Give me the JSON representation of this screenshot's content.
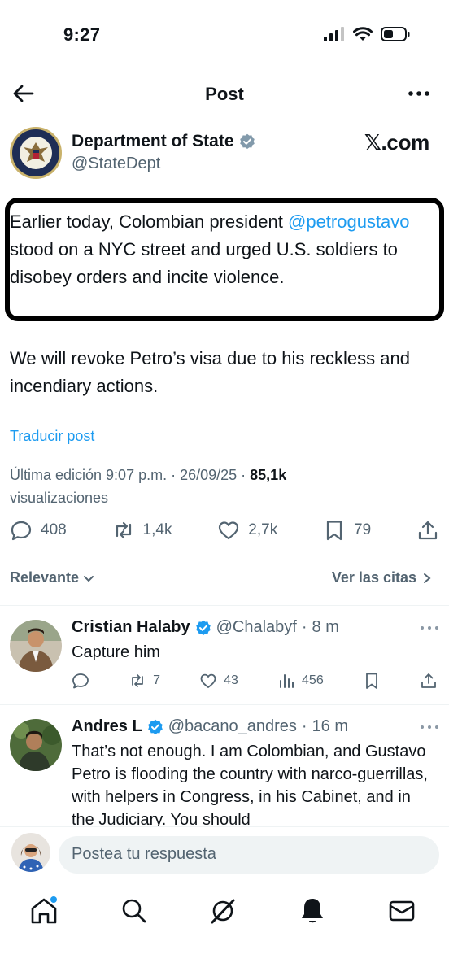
{
  "status_bar": {
    "time": "9:27"
  },
  "header": {
    "title": "Post"
  },
  "author": {
    "name": "Department of State",
    "handle": "@StateDept",
    "source": "𝕏.com"
  },
  "tweet": {
    "p1_before": "Earlier today, Colombian president ",
    "mention": "@petrogustavo",
    "p1_after": " stood on a NYC street and urged U.S. soldiers to disobey orders and incite violence.",
    "p2": "We will revoke Petro’s visa due to his reckless and incendiary actions.",
    "translate": "Traducir post",
    "edited_time": "Última edición 9:07 p.m. · 26/09/25",
    "views": "85,1k",
    "views_label": "visualizaciones"
  },
  "actions": {
    "replies": "408",
    "reposts": "1,4k",
    "likes": "2,7k",
    "bookmarks": "79"
  },
  "sort": {
    "label": "Relevante",
    "quotes": "Ver las citas"
  },
  "replies": [
    {
      "name": "Cristian Halaby",
      "handle": "@Chalabyf",
      "time": "8 m",
      "text": "Capture him",
      "reposts": "7",
      "likes": "43",
      "views": "456"
    },
    {
      "name": "Andres L",
      "handle": "@bacano_andres",
      "time": "16 m",
      "text": "That’s not enough. I am Colombian, and Gustavo Petro is flooding the country with narco-guerrillas, with helpers in Congress, in his Cabinet, and in the Judiciary. You should"
    }
  ],
  "reply_bar": {
    "placeholder": "Postea tu respuesta"
  },
  "colors": {
    "accent": "#1d9bf0",
    "muted": "#536471",
    "text": "#0f1419"
  },
  "icons": [
    "back-arrow-icon",
    "more-icon",
    "verified-icon",
    "reply-icon",
    "repost-icon",
    "like-icon",
    "bookmark-icon",
    "share-icon",
    "views-icon",
    "home-icon",
    "search-icon",
    "grok-icon",
    "bell-icon",
    "mail-icon"
  ]
}
